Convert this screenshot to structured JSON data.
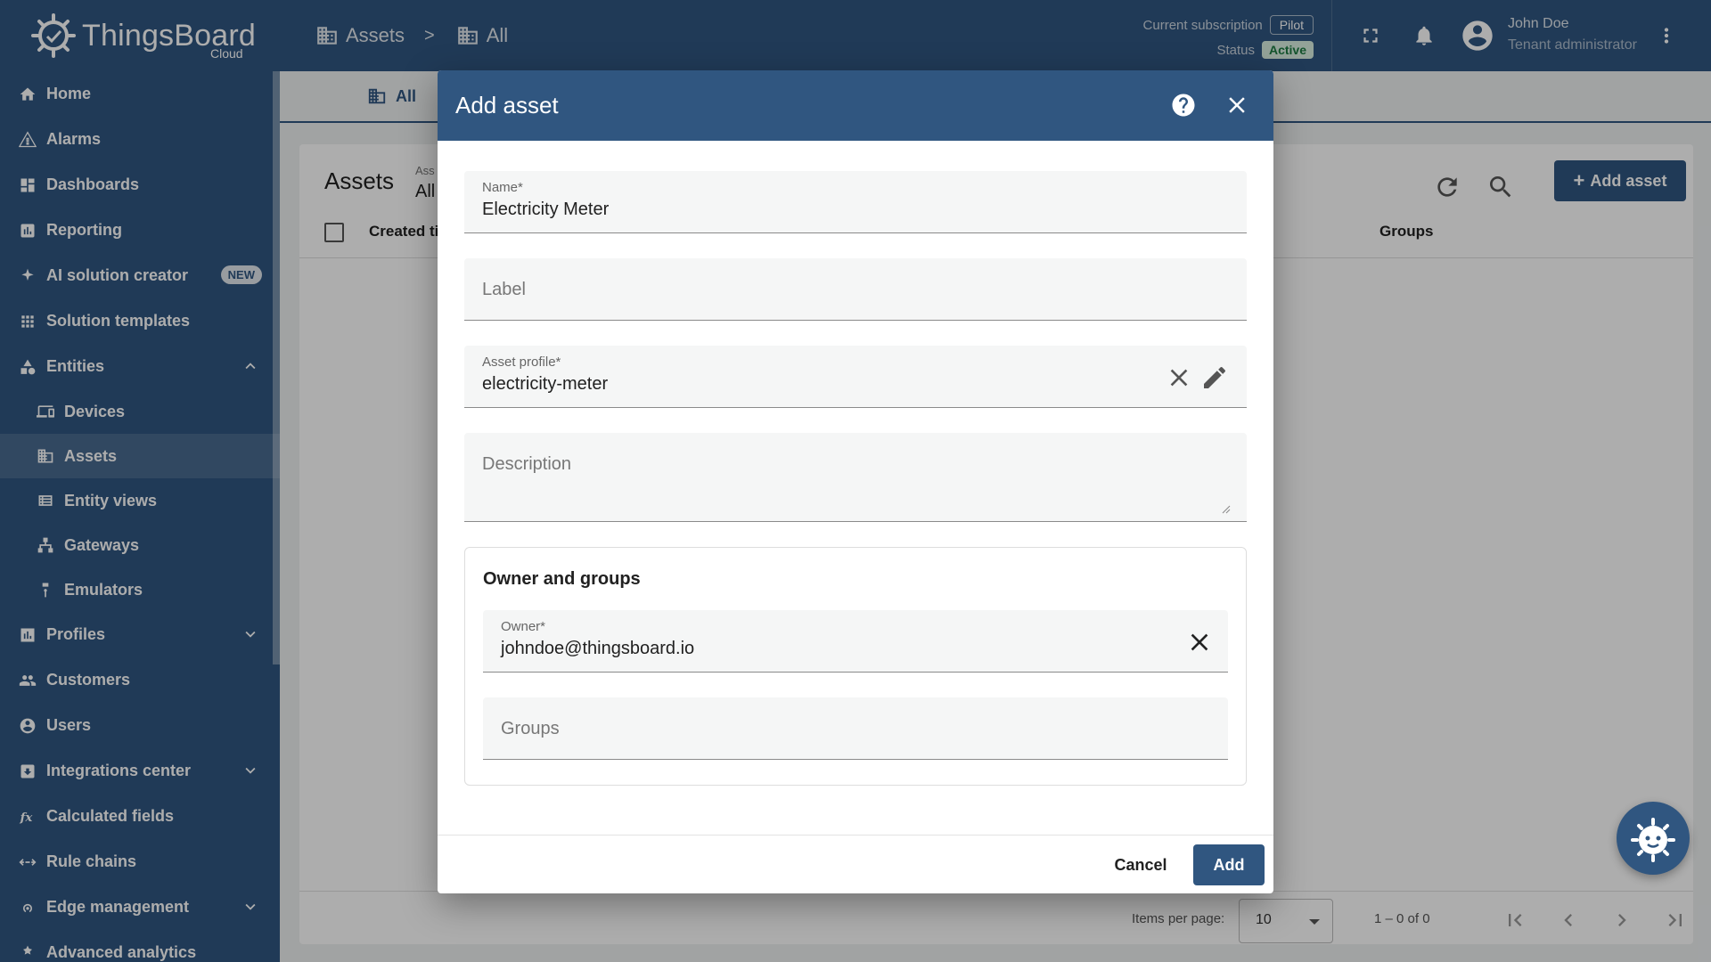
{
  "colors": {
    "primary": "#305680",
    "active_badge_bg": "#d9efe1",
    "active_badge_text": "#1c7b42"
  },
  "brand": {
    "name": "ThingsBoard",
    "sub": "Cloud"
  },
  "breadcrumb": [
    {
      "label": "Assets",
      "icon": "building-icon"
    },
    {
      "label": "All",
      "icon": "building-icon"
    }
  ],
  "breadcrumb_separator": ">",
  "subscription": {
    "label": "Current subscription",
    "plan": "Pilot",
    "status_label": "Status",
    "status": "Active"
  },
  "user": {
    "name": "John Doe",
    "role": "Tenant administrator"
  },
  "sidebar": {
    "items": [
      {
        "label": "Home",
        "icon": "home-icon"
      },
      {
        "label": "Alarms",
        "icon": "alarm-icon"
      },
      {
        "label": "Dashboards",
        "icon": "dashboard-icon"
      },
      {
        "label": "Reporting",
        "icon": "reporting-icon"
      },
      {
        "label": "AI solution creator",
        "icon": "sparkle-icon",
        "badge": "NEW"
      },
      {
        "label": "Solution templates",
        "icon": "apps-icon"
      },
      {
        "label": "Entities",
        "icon": "entities-icon",
        "expanded": true
      },
      {
        "label": "Devices",
        "icon": "devices-icon",
        "sub": true
      },
      {
        "label": "Assets",
        "icon": "building-icon",
        "sub": true,
        "active": true
      },
      {
        "label": "Entity views",
        "icon": "entity-views-icon",
        "sub": true
      },
      {
        "label": "Gateways",
        "icon": "gateway-icon",
        "sub": true
      },
      {
        "label": "Emulators",
        "icon": "emulator-icon",
        "sub": true
      },
      {
        "label": "Profiles",
        "icon": "profiles-icon",
        "collapsible": true
      },
      {
        "label": "Customers",
        "icon": "customers-icon"
      },
      {
        "label": "Users",
        "icon": "users-icon"
      },
      {
        "label": "Integrations center",
        "icon": "integrations-icon",
        "collapsible": true
      },
      {
        "label": "Calculated fields",
        "icon": "function-icon"
      },
      {
        "label": "Rule chains",
        "icon": "rule-chains-icon"
      },
      {
        "label": "Edge management",
        "icon": "edge-icon",
        "collapsible": true
      },
      {
        "label": "Advanced analytics",
        "icon": "analytics-icon"
      }
    ]
  },
  "main": {
    "tab_label": "All",
    "title": "Assets",
    "filter_label": "Ass",
    "filter_value": "All",
    "add_button": "Add asset",
    "columns": {
      "created": "Created ti",
      "groups": "Groups"
    },
    "paginator": {
      "items_per_page_label": "Items per page:",
      "items_per_page": "10",
      "range": "1 – 0 of 0"
    }
  },
  "dialog": {
    "title": "Add asset",
    "name": {
      "label": "Name*",
      "value": "Electricity Meter"
    },
    "label": {
      "placeholder": "Label"
    },
    "asset_profile": {
      "label": "Asset profile*",
      "value": "electricity-meter"
    },
    "description": {
      "placeholder": "Description"
    },
    "owner_section": {
      "title": "Owner and groups",
      "owner": {
        "label": "Owner*",
        "value": "johndoe@thingsboard.io"
      },
      "groups": {
        "placeholder": "Groups"
      }
    },
    "cancel": "Cancel",
    "add": "Add"
  }
}
